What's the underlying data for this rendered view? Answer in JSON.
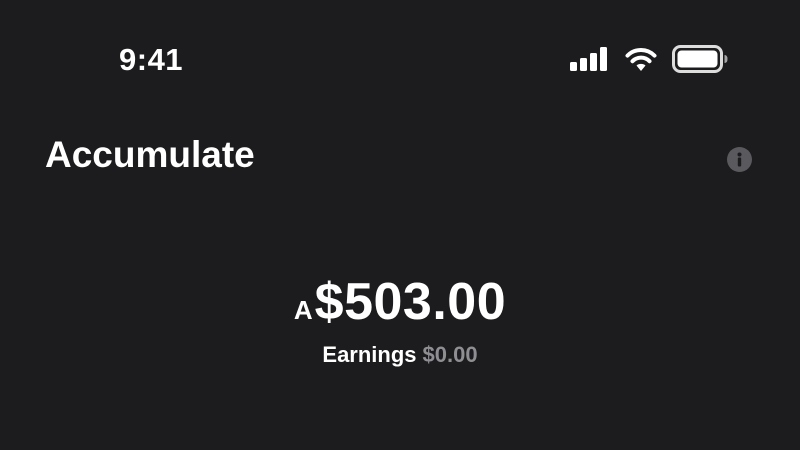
{
  "status_bar": {
    "time": "9:41",
    "icons": [
      "signal-icon",
      "wifi-icon",
      "battery-icon"
    ]
  },
  "header": {
    "title": "Accumulate",
    "info_icon": "info-icon"
  },
  "balance": {
    "currency_prefix": "A",
    "amount": "$503.00"
  },
  "earnings": {
    "label": "Earnings",
    "value": "$0.00"
  },
  "colors": {
    "background": "#1c1c1e",
    "text_primary": "#ffffff",
    "text_secondary": "#8e8e93",
    "info_icon_bg": "#5a5a5e"
  }
}
